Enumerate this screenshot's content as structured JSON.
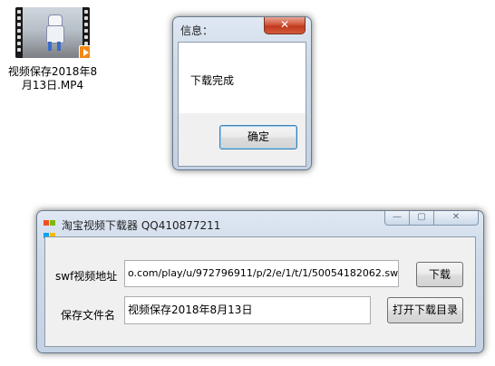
{
  "desktop": {
    "file_name": "视频保存2018年8月13日.MP4"
  },
  "message_box": {
    "title": "信息：",
    "close_label": "✕",
    "message": "下载完成",
    "ok_label": "确定"
  },
  "app_window": {
    "title": "淘宝视频下载器 QQ410877211",
    "min_label": "—",
    "max_label": "▢",
    "close_label": "✕",
    "url_label": "swf视频地址",
    "url_value": "o.com/play/u/972796911/p/2/e/1/t/1/50054182062.swf",
    "download_label": "下载",
    "filename_label": "保存文件名",
    "filename_value": "视频保存2018年8月13日",
    "open_dir_label": "打开下载目录"
  },
  "colors": {
    "accent_blue": "#3c7fb1",
    "close_red": "#c1391f"
  }
}
